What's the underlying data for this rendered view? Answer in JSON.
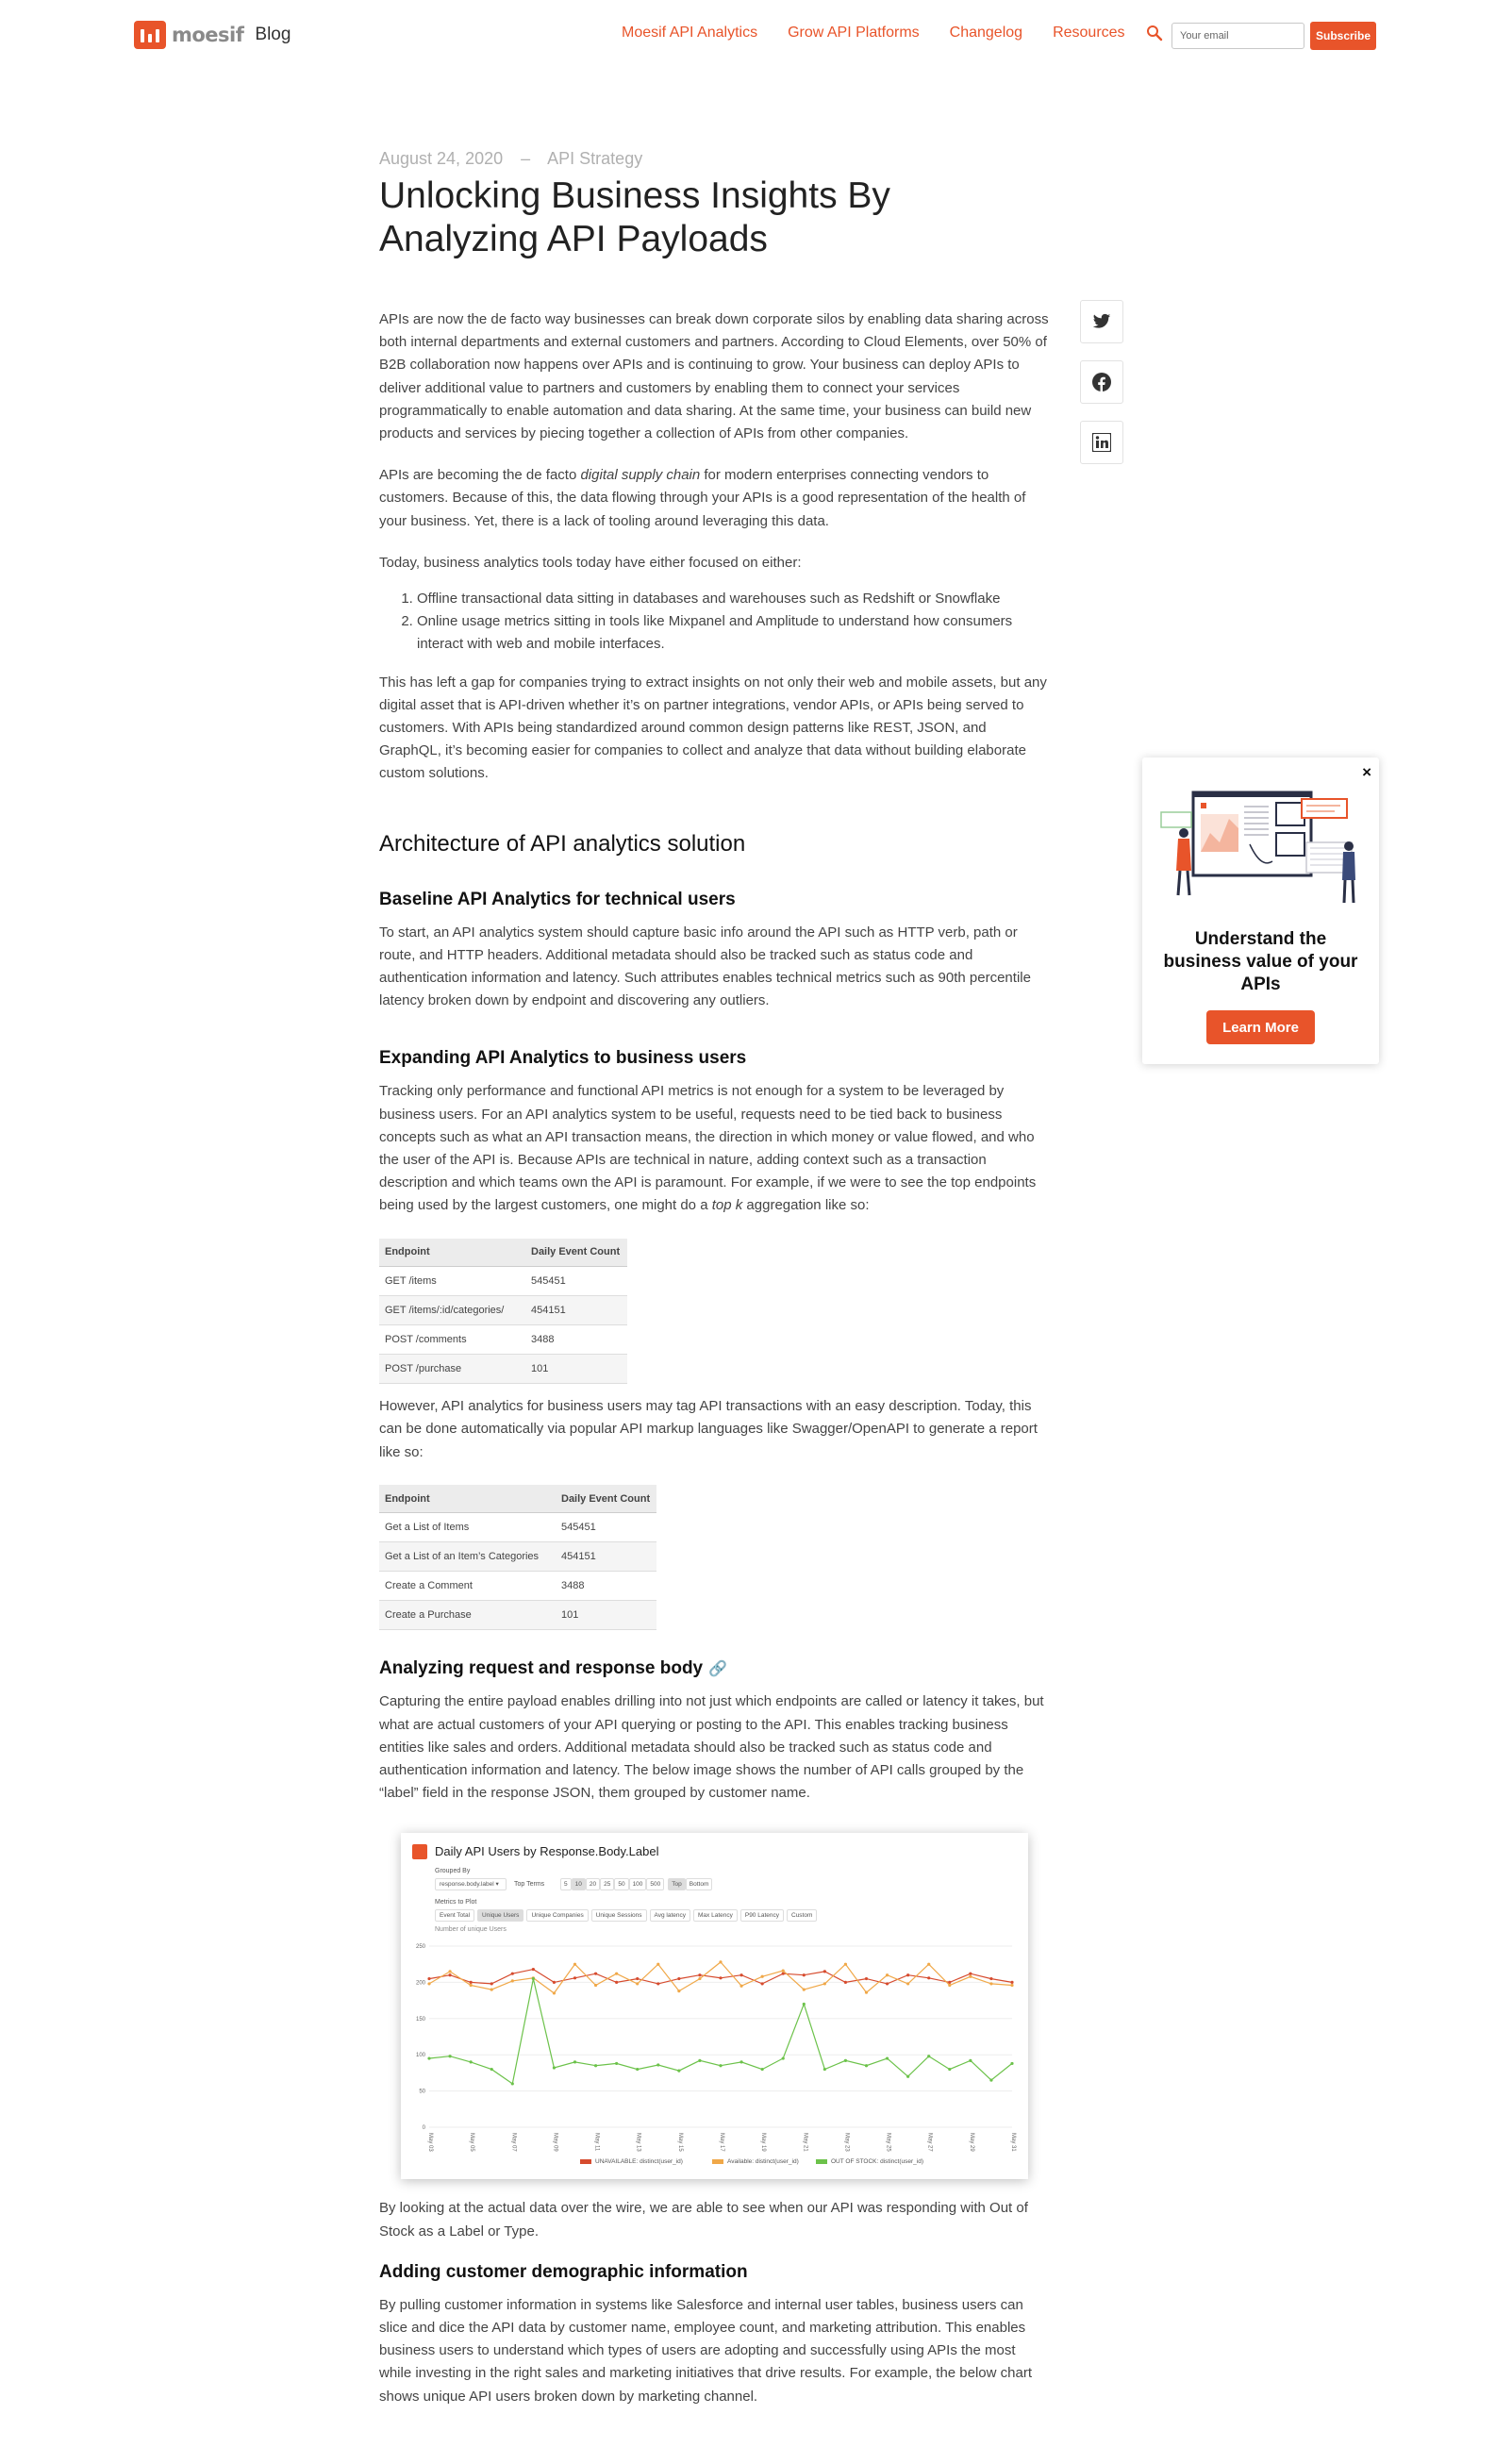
{
  "header": {
    "logo_text": "moesif",
    "blog_label": "Blog",
    "nav": [
      "Moesif API Analytics",
      "Grow API Platforms",
      "Changelog",
      "Resources"
    ],
    "email_placeholder": "Your email",
    "subscribe_label": "Subscribe"
  },
  "post": {
    "date": "August 24, 2020",
    "separator": "–",
    "category": "API Strategy",
    "title": "Unlocking Business Insights By Analyzing API Payloads",
    "p1": "APIs are now the de facto way businesses can break down corporate silos by enabling data sharing across both internal departments and external customers and partners. According to Cloud Elements, over 50% of B2B collaboration now happens over APIs and is continuing to grow. Your business can deploy APIs to deliver additional value to partners and customers by enabling them to connect your services programmatically to enable automation and data sharing. At the same time, your business can build new products and services by piecing together a collection of APIs from other companies.",
    "p2_a": "APIs are becoming the de facto ",
    "p2_em": "digital supply chain",
    "p2_b": " for modern enterprises connecting vendors to customers. Because of this, the data flowing through your APIs is a good representation of the health of your business. Yet, there is a lack of tooling around leveraging this data.",
    "p3": "Today, business analytics tools today have either focused on either:",
    "list": [
      "Offline transactional data sitting in databases and warehouses such as Redshift or Snowflake",
      "Online usage metrics sitting in tools like Mixpanel and Amplitude to understand how consumers interact with web and mobile interfaces."
    ],
    "p4": "This has left a gap for companies trying to extract insights on not only their web and mobile assets, but any digital asset that is API-driven whether it’s on partner integrations, vendor APIs, or APIs being served to customers. With APIs being standardized around common design patterns like REST, JSON, and GraphQL, it’s becoming easier for companies to collect and analyze that data without building elaborate custom solutions.",
    "h2": "Architecture of API analytics solution",
    "h3_1": "Baseline API Analytics for technical users",
    "p5": "To start, an API analytics system should capture basic info around the API such as HTTP verb, path or route, and HTTP headers. Additional metadata should also be tracked such as status code and authentication information and latency. Such attributes enables technical metrics such as 90th percentile latency broken down by endpoint and discovering any outliers.",
    "h3_2": "Expanding API Analytics to business users",
    "p6_a": "Tracking only performance and functional API metrics is not enough for a system to be leveraged by business users. For an API analytics system to be useful, requests need to be tied back to business concepts such as what an API transaction means, the direction in which money or value flowed, and who the user of the API is. Because APIs are technical in nature, adding context such as a transaction description and which teams own the API is paramount. For example, if we were to see the top endpoints being used by the largest customers, one might do a ",
    "p6_em": "top k",
    "p6_b": " aggregation like so:",
    "table1": {
      "headers": [
        "Endpoint",
        "Daily Event Count"
      ],
      "rows": [
        [
          "GET /items",
          "545451"
        ],
        [
          "GET /items/:id/categories/",
          "454151"
        ],
        [
          "POST /comments",
          "3488"
        ],
        [
          "POST /purchase",
          "101"
        ]
      ]
    },
    "p7": "However, API analytics for business users may tag API transactions with an easy description. Today, this can be done automatically via popular API markup languages like Swagger/OpenAPI to generate a report like so:",
    "table2": {
      "headers": [
        "Endpoint",
        "Daily Event Count"
      ],
      "rows": [
        [
          "Get a List of Items",
          "545451"
        ],
        [
          "Get a List of an Item’s Categories",
          "454151"
        ],
        [
          "Create a Comment",
          "3488"
        ],
        [
          "Create a Purchase",
          "101"
        ]
      ]
    },
    "h3_3": "Analyzing request and response body",
    "p8": "Capturing the entire payload enables drilling into not just which endpoints are called or latency it takes, but what are actual customers of your API querying or posting to the API. This enables tracking business entities like sales and orders. Additional metadata should also be tracked such as status code and authentication information and latency. The below image shows the number of API calls grouped by the “label” field in the response JSON, them grouped by customer name.",
    "p9": "By looking at the actual data over the wire, we are able to see when our API was responding with Out of Stock as a Label or Type.",
    "h3_4": "Adding customer demographic information",
    "p10": "By pulling customer information in systems like Salesforce and internal user tables, business users can slice and dice the API data by customer name, employee count, and marketing attribution. This enables business users to understand which types of users are adopting and successfully using APIs the most while investing in the right sales and marketing initiatives that drive results. For example, the below chart shows unique API users broken down by marketing channel."
  },
  "chart_card": {
    "title": "Daily API Users by Response.Body.Label",
    "grouped_by_label": "Grouped By",
    "group_select": "response.body.label",
    "top_terms_label": "Top Terms",
    "top_terms_options": [
      "5",
      "10",
      "20",
      "25",
      "50",
      "100",
      "500"
    ],
    "top_terms_selected": "10",
    "top_toggle": [
      "Top",
      "Bottom"
    ],
    "metrics_label": "Metrics to Plot",
    "metric_tabs": [
      "Event Total",
      "Unique Users",
      "Unique Companies",
      "Unique Sessions",
      "Avg latency",
      "Max Latency",
      "P90 Latency",
      "Custom"
    ],
    "metric_selected": "Unique Users",
    "y_caption": "Number of unique Users",
    "colors": {
      "unavailable": "#d64b2e",
      "available": "#f0a848",
      "out_of_stock": "#6cc24a"
    }
  },
  "chart_data": {
    "type": "line",
    "ylim": [
      0,
      250
    ],
    "y_ticks": [
      0,
      50,
      100,
      150,
      200,
      250
    ],
    "x": [
      "May 03",
      "May 04",
      "May 05",
      "May 06",
      "May 07",
      "May 08",
      "May 09",
      "May 10",
      "May 11",
      "May 12",
      "May 13",
      "May 14",
      "May 15",
      "May 16",
      "May 17",
      "May 18",
      "May 19",
      "May 20",
      "May 21",
      "May 22",
      "May 23",
      "May 24",
      "May 25",
      "May 26",
      "May 27",
      "May 28",
      "May 29",
      "May 30",
      "May 31"
    ],
    "x_tick_labels": [
      "May 03",
      "May 05",
      "May 07",
      "May 09",
      "May 11",
      "May 13",
      "May 15",
      "May 17",
      "May 19",
      "May 21",
      "May 23",
      "May 25",
      "May 27",
      "May 29",
      "May 31"
    ],
    "series": [
      {
        "name": "UNAVAILABLE: distinct(user_id)",
        "values": [
          205,
          210,
          200,
          198,
          212,
          218,
          200,
          206,
          212,
          200,
          205,
          198,
          205,
          210,
          206,
          210,
          198,
          212,
          210,
          215,
          200,
          205,
          198,
          210,
          206,
          200,
          212,
          205,
          200
        ]
      },
      {
        "name": "Available: distinct(user_id)",
        "values": [
          198,
          215,
          196,
          190,
          202,
          206,
          185,
          225,
          196,
          212,
          198,
          225,
          188,
          205,
          228,
          195,
          208,
          216,
          190,
          198,
          225,
          186,
          210,
          198,
          225,
          196,
          208,
          198,
          196
        ]
      },
      {
        "name": "OUT OF STOCK: distinct(user_id)",
        "values": [
          95,
          98,
          90,
          80,
          60,
          205,
          82,
          90,
          85,
          88,
          80,
          86,
          78,
          92,
          85,
          90,
          80,
          95,
          170,
          80,
          92,
          85,
          95,
          70,
          98,
          80,
          92,
          65,
          88
        ]
      }
    ]
  },
  "share_icons": [
    "twitter-icon",
    "facebook-icon",
    "linkedin-icon"
  ],
  "promo": {
    "close_label": "×",
    "text": "Understand the business value of your APIs",
    "button": "Learn More"
  }
}
